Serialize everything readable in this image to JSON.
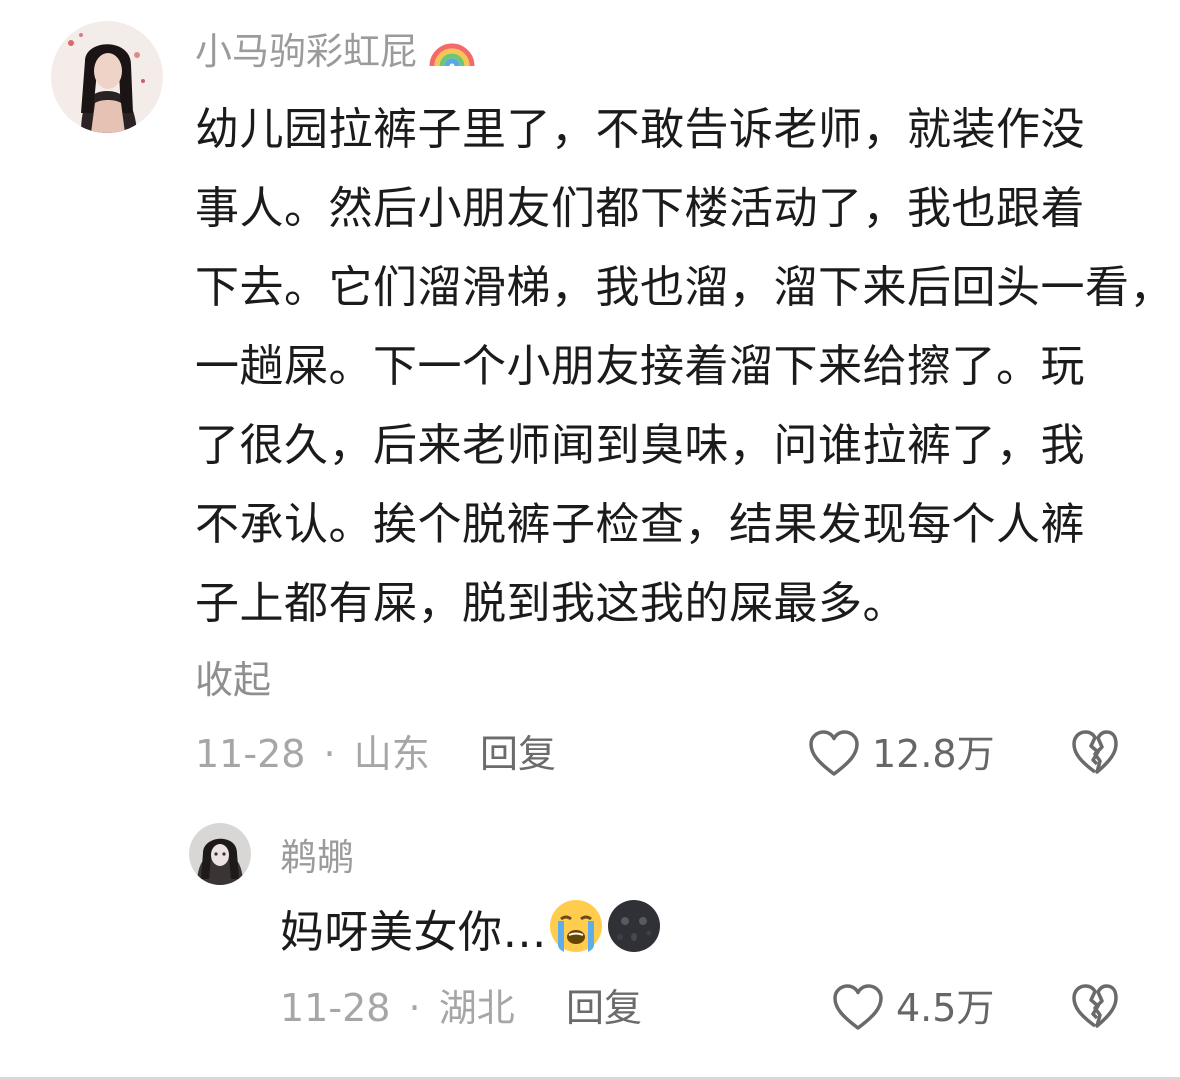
{
  "comments": [
    {
      "username": "小马驹彩虹屁",
      "username_emoji": "rainbow-icon",
      "lines": [
        "幼儿园拉裤子里了，不敢告诉老师，就装作没",
        "事人。然后小朋友们都下楼活动了，我也跟着",
        "下去。它们溜滑梯，我也溜，溜下来后回头一看，",
        "一趟屎。下一个小朋友接着溜下来给擦了。玩",
        "了很久，后来老师闻到臭味，问谁拉裤了，我",
        "不承认。挨个脱裤子检查，结果发现每个人裤",
        "子上都有屎，脱到我这我的屎最多。"
      ],
      "collapse_label": "收起",
      "date": "11-28",
      "separator": "·",
      "location": "山东",
      "reply_label": "回复",
      "likes": "12.8万"
    },
    {
      "username": "鹈鹕",
      "text": "妈呀美女你…",
      "emojis": [
        "loudly-crying-face-icon",
        "new-moon-face-icon"
      ],
      "date": "11-28",
      "separator": "·",
      "location": "湖北",
      "reply_label": "回复",
      "likes": "4.5万"
    }
  ],
  "colors": {
    "text": "#1b1b1b",
    "muted": "#9b9b9b",
    "background": "#ffffff"
  }
}
